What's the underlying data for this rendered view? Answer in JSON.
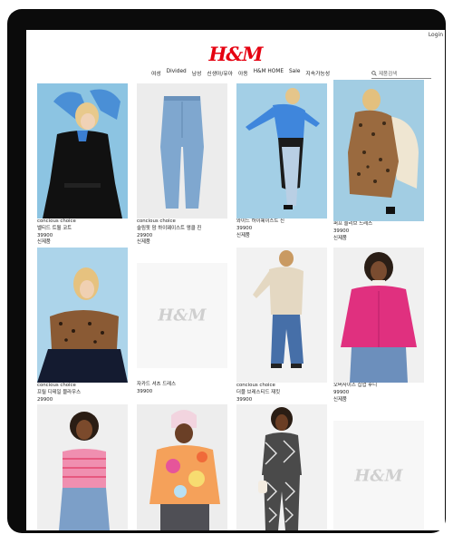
{
  "login": "Login",
  "logo": "H&M",
  "nav": [
    "여성",
    "Divided",
    "남성",
    "신생아/유아",
    "아동",
    "H&M HOME",
    "Sale",
    "지속가능성"
  ],
  "search_placeholder": "제품검색",
  "placeholder_logo": "H&M",
  "products": [
    {
      "tag": "concious choice",
      "name": "벨티드 트윌 코트",
      "price": "39900",
      "badge": "신제품",
      "image": "model-blue-sweater-black-coat"
    },
    {
      "tag": "concious choice",
      "name": "슬림핏 맘 하이웨이스트 앵클 진",
      "price": "29900",
      "badge": "신제품",
      "image": "light-blue-jeans"
    },
    {
      "tag": "",
      "name": "와이드 하이웨이스트 진",
      "price": "39900",
      "badge": "신제품",
      "image": "model-blue-sweater-wide-jeans"
    },
    {
      "tag": "",
      "name": "퍼프 슬리브 드레스",
      "price": "39900",
      "badge": "신제품",
      "image": "model-leopard-dress-chair"
    },
    {
      "tag": "concious choice",
      "name": "프릴 디테일 블라우스",
      "price": "29900",
      "badge": "",
      "image": "model-leopard-blouse"
    },
    {
      "tag": "",
      "name": "자카드 셔츠 드레스",
      "price": "39900",
      "badge": "",
      "image": "placeholder"
    },
    {
      "tag": "concious choice",
      "name": "더블 브레스티드 재킷",
      "price": "39900",
      "badge": "",
      "image": "model-beige-blazer"
    },
    {
      "tag": "",
      "name": "오버사이즈 집업 후디",
      "price": "99900",
      "badge": "신제품",
      "image": "model-pink-hoodie"
    },
    {
      "tag": "",
      "name": "",
      "price": "",
      "badge": "",
      "image": "model-striped-top"
    },
    {
      "tag": "",
      "name": "",
      "price": "",
      "badge": "",
      "image": "model-tiedye-shirt"
    },
    {
      "tag": "",
      "name": "",
      "price": "",
      "badge": "",
      "image": "model-patterned-set"
    },
    {
      "tag": "",
      "name": "",
      "price": "",
      "badge": "",
      "image": "placeholder"
    }
  ]
}
